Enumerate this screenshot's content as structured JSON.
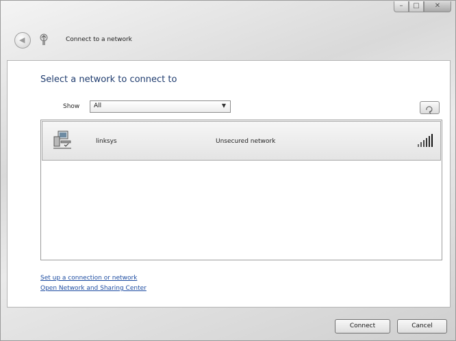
{
  "window": {
    "title": "Connect to a network",
    "caption_buttons": [
      "minimize",
      "maximize",
      "close"
    ]
  },
  "main": {
    "heading": "Select a network to connect to",
    "show_label": "Show",
    "show_selected": "All",
    "refresh_tooltip_icon": "refresh-icon"
  },
  "networks": [
    {
      "name": "linksys",
      "status": "Unsecured network",
      "icon": "computer-network-icon",
      "signal_icon": "signal-strength-icon",
      "selected": true
    }
  ],
  "links": {
    "setup": "Set up a connection or network",
    "sharing": "Open Network and Sharing Center"
  },
  "buttons": {
    "connect": "Connect",
    "cancel": "Cancel"
  },
  "colors": {
    "heading": "#1e3b6e",
    "link": "#1a4aa0"
  }
}
